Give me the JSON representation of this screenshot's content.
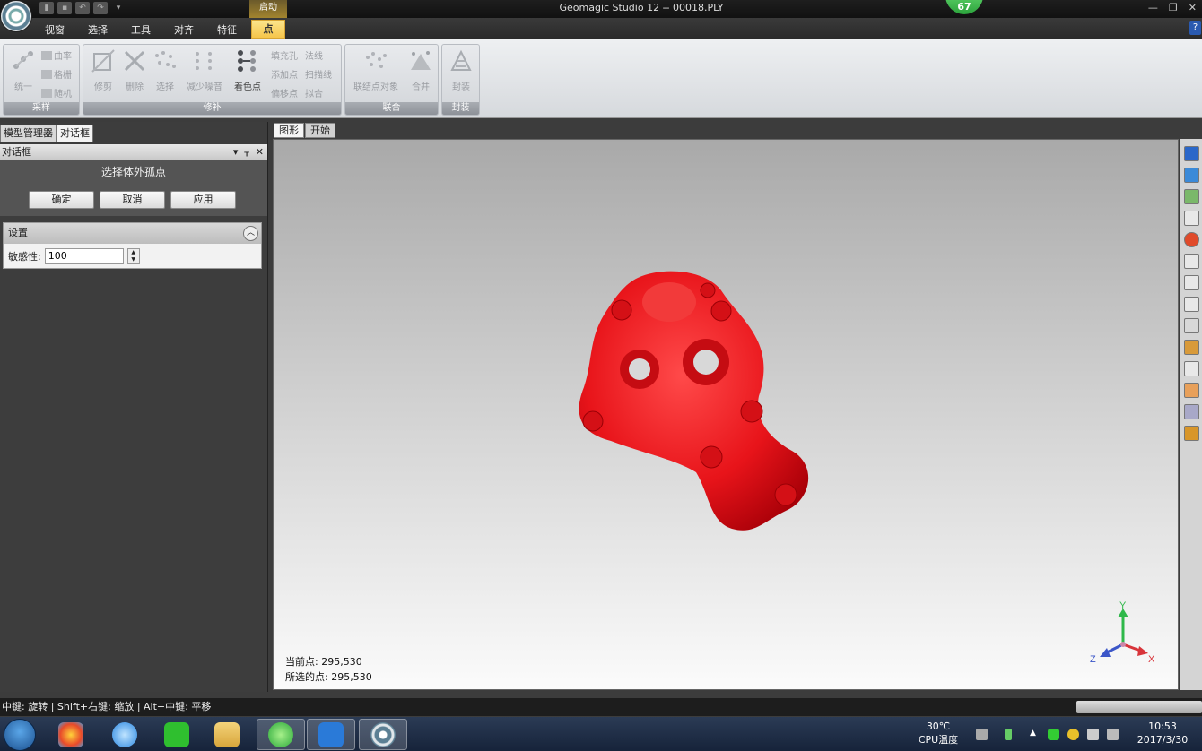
{
  "titlebar": {
    "start_tab": "启动",
    "title": "Geomagic Studio 12 -- 00018.PLY",
    "badge": "67",
    "win_min": "—",
    "win_max": "❐",
    "win_close": "✕"
  },
  "menu": {
    "items": [
      "视窗",
      "选择",
      "工具",
      "对齐",
      "特征"
    ],
    "active": "点",
    "help": "?"
  },
  "ribbon": {
    "groups": {
      "sampling": {
        "label": "采样",
        "unify": "统一",
        "curvature": "曲率",
        "grid": "格栅",
        "random": "随机"
      },
      "repair": {
        "label": "修补",
        "trim": "修剪",
        "delete": "删除",
        "select": "选择",
        "reduce_noise": "减少噪音",
        "color_points": "着色点",
        "fill_hole": "填充孔",
        "normals": "法线",
        "add_points": "添加点",
        "scan_lines": "扫描线",
        "offset_points": "偏移点",
        "fit": "拟合"
      },
      "combine": {
        "label": "联合",
        "join_objects": "联结点对象",
        "merge": "合并"
      },
      "wrap": {
        "label": "封装",
        "wrap": "封装"
      }
    }
  },
  "left_panel": {
    "tabs": [
      "模型管理器",
      "对话框"
    ],
    "header": "对话框",
    "header_ctrls": [
      "▾",
      "ᚁ",
      "✕"
    ],
    "dialog_title": "选择体外孤点",
    "buttons": {
      "ok": "确定",
      "cancel": "取消",
      "apply": "应用"
    },
    "settings": {
      "title": "设置",
      "sensitivity_label": "敏感性:",
      "sensitivity_value": "100"
    }
  },
  "viewport": {
    "tabs": [
      "图形",
      "开始"
    ],
    "model_color": "#e8141a",
    "current_points": "当前点: 295,530",
    "selected_points": "所选的点: 295,530",
    "axes": {
      "x": "X",
      "y": "Y",
      "z": "Z"
    }
  },
  "statusbar": {
    "hint": "中键: 旋转 | Shift+右键: 缩放 | Alt+中键: 平移"
  },
  "taskbar": {
    "cpu_temp_value": "30℃",
    "cpu_temp_label": "CPU温度",
    "time": "10:53",
    "date": "2017/3/30"
  }
}
